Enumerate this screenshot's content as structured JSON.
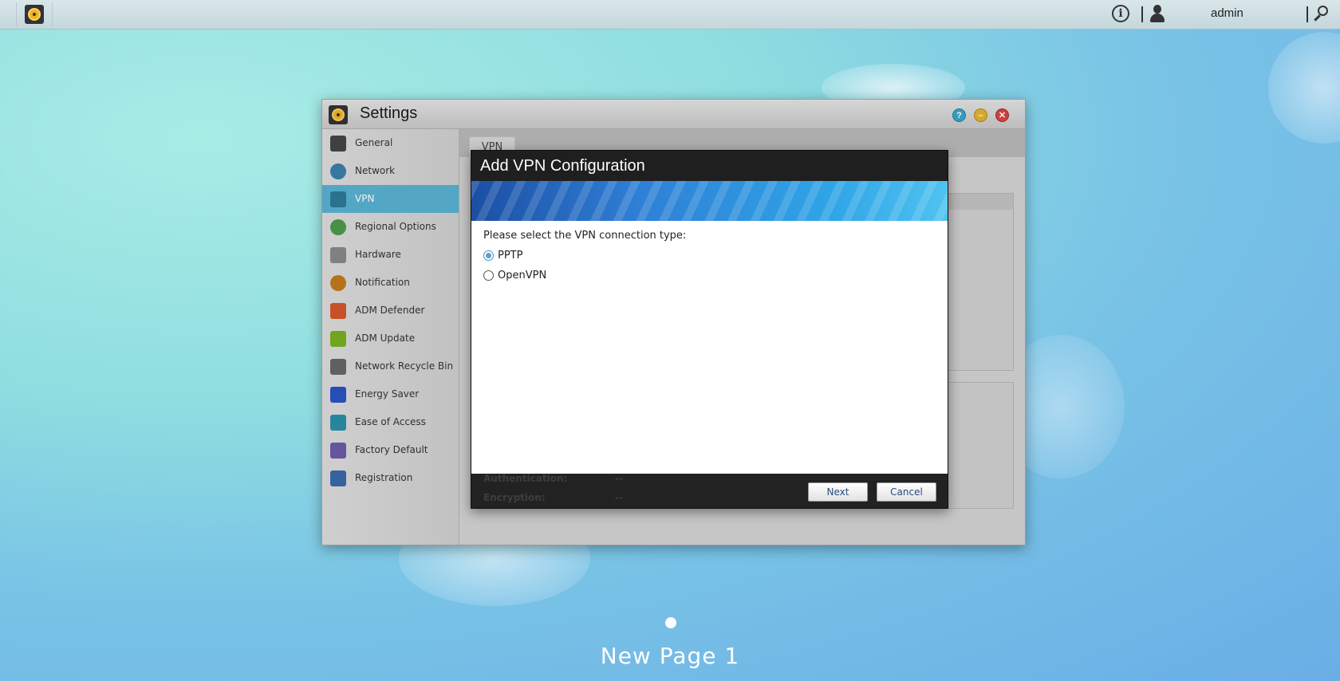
{
  "topbar": {
    "username": "admin"
  },
  "settings_window": {
    "title": "Settings",
    "help_label": "?",
    "minimize_label": "–",
    "close_label": "✕",
    "sidebar": {
      "items": [
        {
          "label": "General",
          "icon": "server-icon",
          "color": "#444444"
        },
        {
          "label": "Network",
          "icon": "globe-icon",
          "color": "#3a7fa8"
        },
        {
          "label": "VPN",
          "icon": "vpn-house-icon",
          "color": "#2e7a9a",
          "active": true
        },
        {
          "label": "Regional Options",
          "icon": "regional-globe-icon",
          "color": "#4c9a4c"
        },
        {
          "label": "Hardware",
          "icon": "hardware-icon",
          "color": "#888888"
        },
        {
          "label": "Notification",
          "icon": "exclamation-icon",
          "color": "#c27a1c"
        },
        {
          "label": "ADM Defender",
          "icon": "firewall-icon",
          "color": "#d4582b"
        },
        {
          "label": "ADM Update",
          "icon": "up-arrow-icon",
          "color": "#7ab020"
        },
        {
          "label": "Network Recycle Bin",
          "icon": "trash-icon",
          "color": "#666666"
        },
        {
          "label": "Energy Saver",
          "icon": "lightning-icon",
          "color": "#2a52c2"
        },
        {
          "label": "Ease of Access",
          "icon": "cloud-icon",
          "color": "#2a8fa8"
        },
        {
          "label": "Factory Default",
          "icon": "undo-icon",
          "color": "#6e5aa8"
        },
        {
          "label": "Registration",
          "icon": "clipboard-icon",
          "color": "#3a6aa8"
        }
      ]
    },
    "tab_label": "VPN"
  },
  "dialog": {
    "title": "Add VPN Configuration",
    "prompt": "Please select the VPN connection type:",
    "options": [
      {
        "label": "PPTP",
        "checked": true
      },
      {
        "label": "OpenVPN",
        "checked": false
      }
    ],
    "background_labels": {
      "authentication": "Authentication:",
      "authentication_value": "--",
      "encryption": "Encryption:",
      "encryption_value": "--"
    },
    "next_label": "Next",
    "cancel_label": "Cancel"
  },
  "desktop": {
    "page_name": "New Page 1"
  }
}
